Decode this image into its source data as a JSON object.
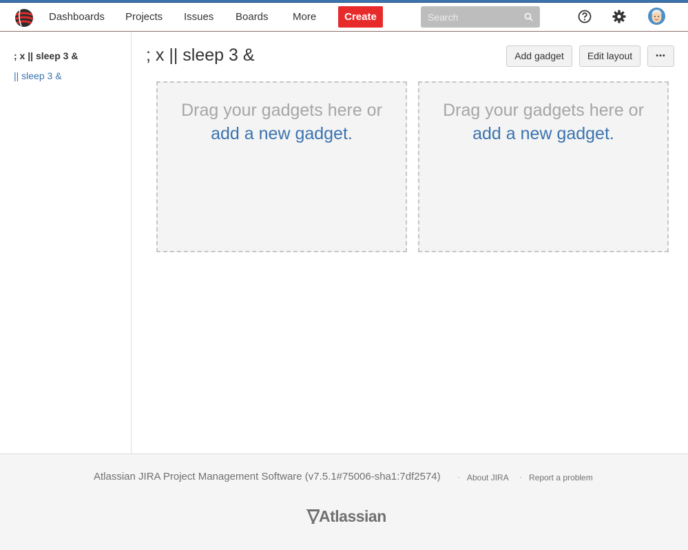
{
  "header": {
    "nav": [
      "Dashboards",
      "Projects",
      "Issues",
      "Boards",
      "More"
    ],
    "create_label": "Create",
    "search_placeholder": "Search"
  },
  "sidebar": {
    "heading": "; x || sleep 3 &",
    "link": "|| sleep 3 &"
  },
  "main": {
    "title": "; x || sleep 3 &",
    "add_gadget_label": "Add gadget",
    "edit_layout_label": "Edit layout",
    "more_label": "•••",
    "dropzone_text": "Drag your gadgets here or",
    "dropzone_link": "add a new gadget."
  },
  "footer": {
    "version": "Atlassian JIRA Project Management Software (v7.5.1#75006-sha1:7df2574)",
    "separator": "·",
    "about_label": "About JIRA",
    "report_label": "Report a problem",
    "brand": "Atlassian"
  },
  "colors": {
    "accent": "#3b73af",
    "create": "#e72b2b"
  }
}
